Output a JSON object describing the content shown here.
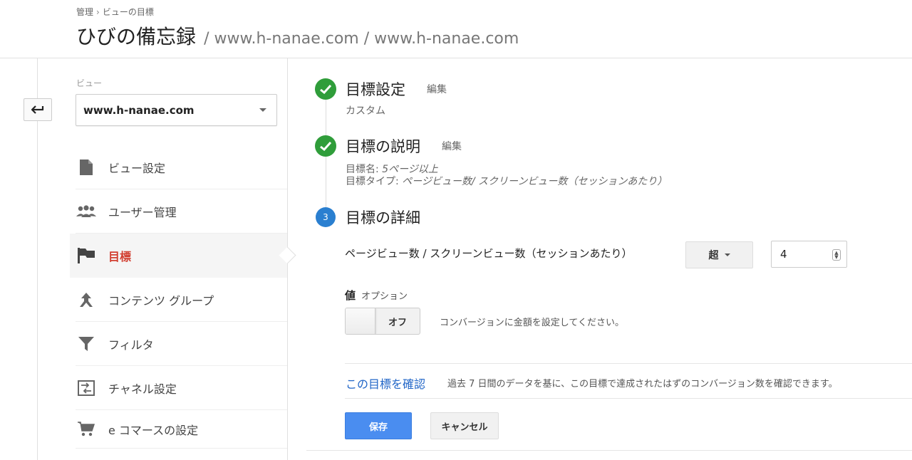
{
  "breadcrumb": {
    "items": [
      "管理",
      "ビューの目標"
    ],
    "separator": "›"
  },
  "title": {
    "main": "ひびの備忘録",
    "sub": "/ www.h-nanae.com / www.h-nanae.com"
  },
  "sidebar": {
    "view_label": "ビュー",
    "view_selected": "www.h-nanae.com",
    "items": [
      {
        "label": "ビュー設定",
        "icon": "document-icon"
      },
      {
        "label": "ユーザー管理",
        "icon": "people-icon"
      },
      {
        "label": "目標",
        "icon": "flag-icon",
        "active": true
      },
      {
        "label": "コンテンツ グループ",
        "icon": "content-group-icon"
      },
      {
        "label": "フィルタ",
        "icon": "filter-icon"
      },
      {
        "label": "チャネル設定",
        "icon": "channel-settings-icon"
      },
      {
        "label": "e コマースの設定",
        "icon": "cart-icon"
      }
    ]
  },
  "steps": [
    {
      "title": "目標設定",
      "edit": "編集",
      "detail": "カスタム",
      "status": "done"
    },
    {
      "title": "目標の説明",
      "edit": "編集",
      "detail_name_label": "目標名:",
      "detail_name_value": "5ページ以上",
      "detail_type_label": "目標タイプ:",
      "detail_type_value": "ページビュー数/ スクリーンビュー数（セッションあたり）",
      "status": "done"
    },
    {
      "number": "3",
      "title": "目標の詳細",
      "status": "current"
    }
  ],
  "details": {
    "metric_label": "ページビュー数 / スクリーンビュー数（セッションあたり）",
    "operator": "超",
    "value": "4",
    "value_label": "値",
    "value_option": "オプション",
    "toggle_label": "オフ",
    "toggle_hint": "コンバージョンに金額を設定してください。",
    "verify_link": "この目標を確認",
    "verify_hint": "過去 7 日間のデータを基に、この目標で達成されたはずのコンバージョン数を確認できます。"
  },
  "buttons": {
    "save": "保存",
    "cancel": "キャンセル"
  },
  "colors": {
    "primary": "#4a8df0",
    "success": "#2f9d3a",
    "step_current": "#2a7fd0",
    "active_nav": "#d23f31",
    "link": "#2065c7"
  }
}
